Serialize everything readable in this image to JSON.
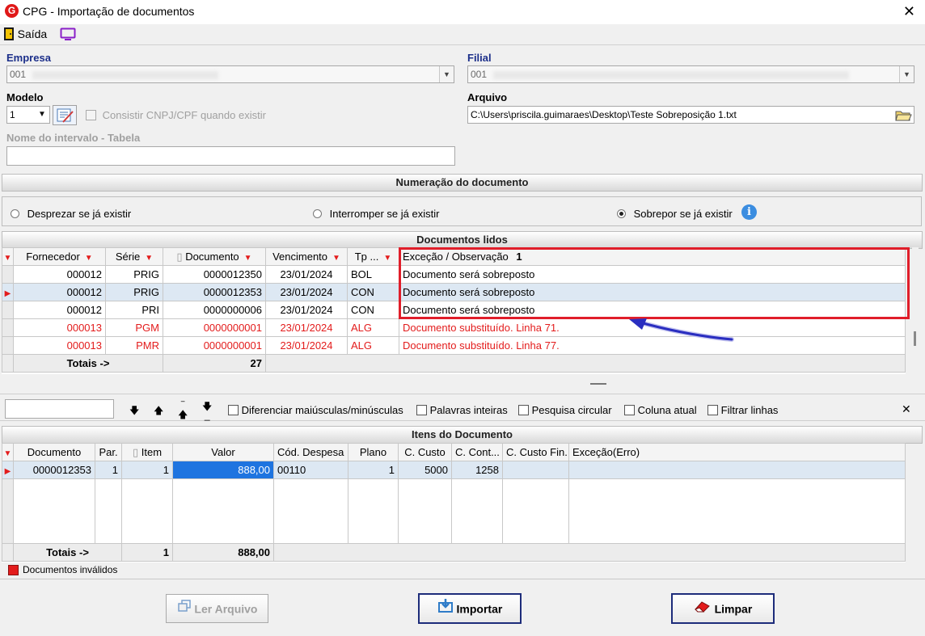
{
  "window": {
    "title": "CPG - Importação de documentos",
    "logo": "G",
    "close": "✕"
  },
  "toolbar": {
    "exit_label": "Saída"
  },
  "form": {
    "empresa_label": "Empresa",
    "empresa_value": "001",
    "filial_label": "Filial",
    "filial_value": "001",
    "modelo_label": "Modelo",
    "modelo_value": "1",
    "consistir_label": "Consistir CNPJ/CPF quando existir",
    "arquivo_label": "Arquivo",
    "arquivo_value": "C:\\Users\\priscila.guimaraes\\Desktop\\Teste Sobreposição 1.txt",
    "intervalo_label": "Nome do intervalo - Tabela",
    "intervalo_value": ""
  },
  "numeracao": {
    "title": "Numeração do documento",
    "options": [
      "Desprezar se já existir",
      "Interromper se já existir",
      "Sobrepor se já existir"
    ],
    "selected": "Sobrepor se já existir"
  },
  "docs": {
    "title": "Documentos lidos",
    "columns": [
      "Fornecedor",
      "Série",
      "Documento",
      "Vencimento",
      "Tp ...",
      "Exceção / Observação"
    ],
    "sort_marker": "1",
    "rows": [
      [
        "000012",
        "PRIG",
        "0000012350",
        "23/01/2024",
        "BOL",
        "Documento será sobreposto"
      ],
      [
        "000012",
        "PRIG",
        "0000012353",
        "23/01/2024",
        "CON",
        "Documento será sobreposto"
      ],
      [
        "000012",
        "PRI",
        "0000000006",
        "23/01/2024",
        "CON",
        "Documento será sobreposto"
      ],
      [
        "000013",
        "PGM",
        "0000000001",
        "23/01/2024",
        "ALG",
        "Documento substituído. Linha 71."
      ],
      [
        "000013",
        "PMR",
        "0000000001",
        "23/01/2024",
        "ALG",
        "Documento substituído. Linha 77."
      ]
    ],
    "totals_label": "Totais ->",
    "totals_value": "27"
  },
  "search": {
    "value": "",
    "opt1": "Diferenciar maiúsculas/minúsculas",
    "opt2": "Palavras inteiras",
    "opt3": "Pesquisa circular",
    "opt4": "Coluna atual",
    "opt5": "Filtrar linhas",
    "close": "✕"
  },
  "itens": {
    "title": "Itens do Documento",
    "columns": [
      "Documento",
      "Par.",
      "Item",
      "Valor",
      "Cód. Despesa",
      "Plano",
      "C. Custo",
      "C. Cont...",
      "C. Custo Fin.",
      "Exceção(Erro)"
    ],
    "rows": [
      [
        "0000012353",
        "1",
        "1",
        "888,00",
        "00110",
        "1",
        "5000",
        "1258",
        "",
        ""
      ]
    ],
    "totals_label": "Totais ->",
    "totals_item": "1",
    "totals_valor": "888,00"
  },
  "legend": {
    "invalid_label": "Documentos inválidos",
    "invalid_color": "#e31c1c"
  },
  "buttons": {
    "ler": "Ler Arquivo",
    "importar": "Importar",
    "limpar": "Limpar"
  },
  "colors": {
    "accent": "#1d2c7a",
    "highlight": "#e01e2a",
    "arrow": "#2a2ec0",
    "selection": "#1e74e0"
  }
}
